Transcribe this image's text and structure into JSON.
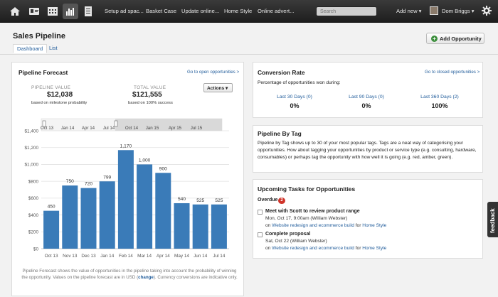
{
  "nav": {
    "links": [
      "Setup ad spac...",
      "Basket Case",
      "Update online...",
      "Home Style",
      "Online advert..."
    ],
    "search_placeholder": "Search",
    "add_new": "Add new ▾",
    "user": "Dom Briggs ▾"
  },
  "header": {
    "title": "Sales Pipeline",
    "tabs": [
      "Dashboard",
      "List"
    ],
    "add_button": "Add Opportunity"
  },
  "forecast": {
    "title": "Pipeline Forecast",
    "link": "Go to open opportunities >",
    "pipeline_label": "PIPELINE VALUE",
    "pipeline_value": "$12,038",
    "pipeline_sub": "based on milestone probability",
    "total_label": "TOTAL VALUE",
    "total_value": "$121,555",
    "total_sub": "based on 100% success",
    "actions": "Actions ▾",
    "footnote_1": "Pipeline Forecast shows the value of opportunities in the pipeline taking into account the probability of winning the opportunity. Values on the pipeline forecast are in USD (",
    "footnote_link": "change",
    "footnote_2": "). Currency conversions are indicative only."
  },
  "chart_data": {
    "type": "bar",
    "categories": [
      "Oct 13",
      "Nov 13",
      "Dec 13",
      "Jan 14",
      "Feb 14",
      "Mar 14",
      "Apr 14",
      "May 14",
      "Jun 14",
      "Jul 14"
    ],
    "values": [
      450,
      750,
      720,
      799,
      1170,
      1000,
      900,
      540,
      525,
      525
    ],
    "data_labels": [
      "450",
      "750",
      "720",
      "799",
      "1,170",
      "1,000",
      "900",
      "540",
      "525",
      "525"
    ],
    "ylim": [
      0,
      1400
    ],
    "yticks": [
      "$0",
      "$200",
      "$400",
      "$600",
      "$800",
      "$1,000",
      "$1,200",
      "$1,400"
    ],
    "navigator_ticks": [
      "Oct 13",
      "Jan 14",
      "Apr 14",
      "Jul 14",
      "Oct 14",
      "Jan 15",
      "Apr 15",
      "Jul 15"
    ],
    "bar_color": "#3a7bb8",
    "grid": true
  },
  "conversion": {
    "title": "Conversion Rate",
    "link": "Go to closed opportunities >",
    "desc": "Percentage of opportunities won during:",
    "cols": [
      {
        "label": "Last 30 Days (0)",
        "value": "0%"
      },
      {
        "label": "Last 90 Days (0)",
        "value": "0%"
      },
      {
        "label": "Last 360 Days (2)",
        "value": "100%"
      }
    ]
  },
  "tags": {
    "title": "Pipeline By Tag",
    "desc": "Pipeline by Tag shows up to 30 of your most popular tags. Tags are a neat way of categorising your opportunities. How about tagging your opportunities by product or service type (e.g. consulting, hardware, consumables) or perhaps tag the opportunity with how well it is going (e.g. red, amber, green)."
  },
  "tasks": {
    "title": "Upcoming Tasks for Opportunities",
    "overdue": "Overdue",
    "count": "2",
    "items": [
      {
        "title": "Meet with Scott to review product range",
        "date": "Mon, Oct 17, 9:00am (William Webster)",
        "on": "on ",
        "opp": "Website redesign and ecommerce build",
        "for": " for ",
        "client": "Home Style"
      },
      {
        "title": "Complete proposal",
        "date": "Sat, Oct 22 (William Webster)",
        "on": "on ",
        "opp": "Website redesign and ecommerce build",
        "for": " for ",
        "client": "Home Style"
      }
    ]
  },
  "feedback": "feedback",
  "colors": {
    "accent": "#1f5b9a",
    "bar": "#3a7bb8",
    "badge": "#d0352b"
  }
}
